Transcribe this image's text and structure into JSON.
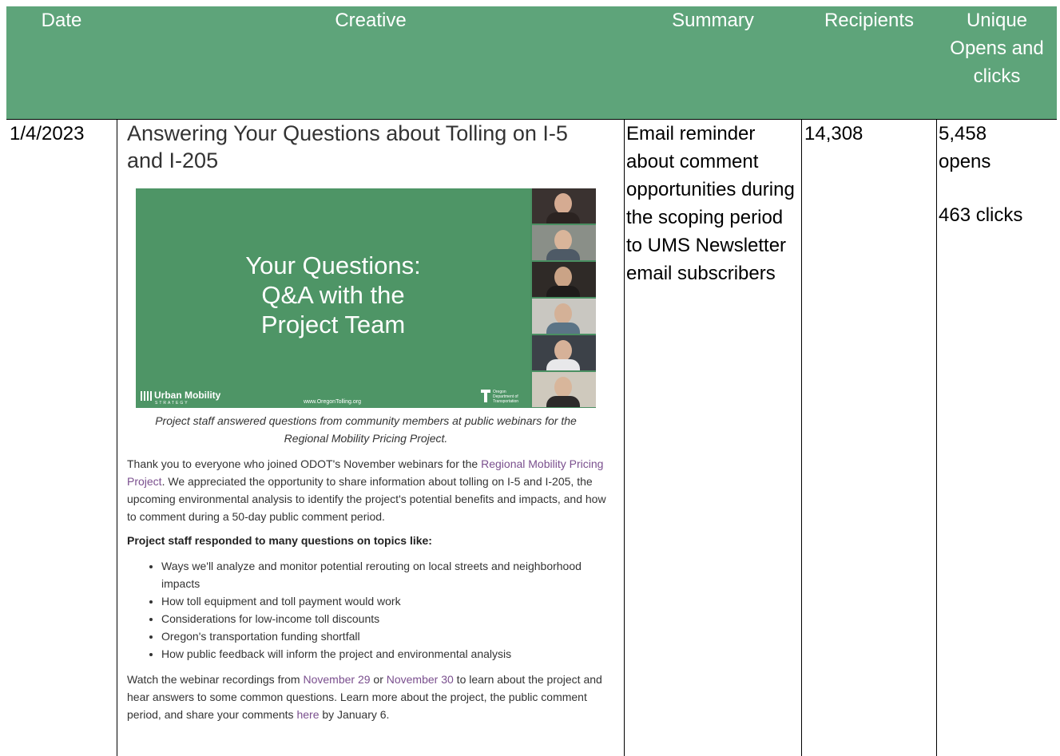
{
  "header": {
    "date": "Date",
    "creative": "Creative",
    "summary": "Summary",
    "recipients": "Recipients",
    "unique_line1": "Unique",
    "unique_line2": "Opens and",
    "unique_line3": "clicks"
  },
  "row": {
    "date": "1/4/2023",
    "summary": "Email reminder about comment opportunities during the scoping period to UMS Newsletter email subscribers",
    "recipients": "14,308",
    "opens": "5,458 opens",
    "clicks": "463 clicks"
  },
  "creative": {
    "title": "Answering Your Questions about Tolling on I-5 and I-205",
    "banner_line1": "Your Questions:",
    "banner_line2": "Q&A with the",
    "banner_line3": "Project Team",
    "logo_urban": "Urban Mobility",
    "logo_urban_sub": "STRATEGY",
    "logo_url": "www.OregonTolling.org",
    "logo_odot": "Oregon Department of Transportation",
    "caption": "Project staff answered questions from community members at public webinars for the Regional Mobility Pricing Project.",
    "para1_a": "Thank you to everyone who joined ODOT's November webinars for the ",
    "para1_link": "Regional Mobility Pricing Project",
    "para1_b": ". We appreciated the opportunity to share information about tolling on I-5 and I-205, the upcoming environmental analysis to identify the project's potential benefits and impacts, and how to comment during a 50-day public comment period.",
    "topics_heading": "Project staff responded to many questions on topics like:",
    "topics": [
      "Ways we'll analyze and monitor potential rerouting on local streets and neighborhood impacts",
      "How toll equipment and toll payment would work",
      "Considerations for low-income toll discounts",
      "Oregon's transportation funding shortfall",
      "How public feedback will inform the project and environmental analysis"
    ],
    "para2_a": "Watch the webinar recordings from ",
    "para2_link1": "November 29",
    "para2_b": " or ",
    "para2_link2": "November 30",
    "para2_c": " to learn about the project and hear answers to some common questions. Learn more about the project, the public comment period, and share your comments ",
    "para2_link3": "here",
    "para2_d": " by January 6."
  },
  "colors": {
    "header_bg": "#5ea47a",
    "banner_bg": "#4e9566",
    "link": "#7a4f8e"
  }
}
